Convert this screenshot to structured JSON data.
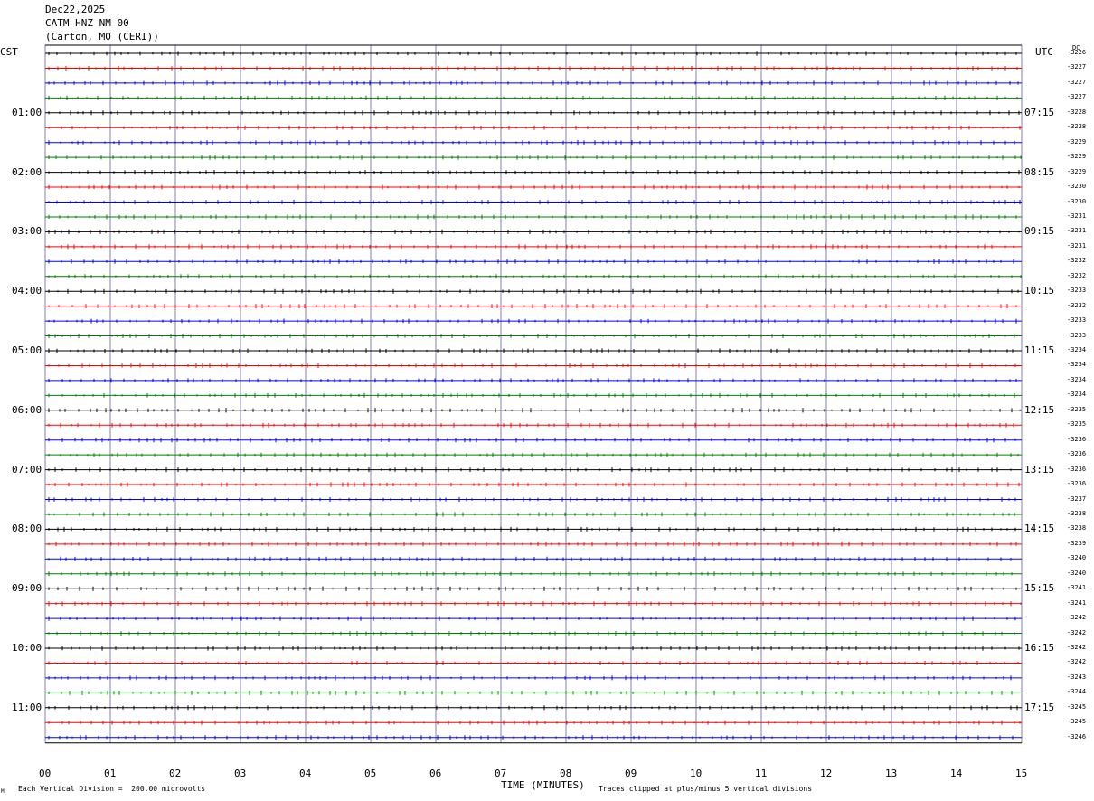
{
  "header": {
    "date": "Dec22,2025",
    "station": "CATM HNZ NM 00",
    "location": "(Carton, MO (CERI))"
  },
  "axes": {
    "left_label": "CST",
    "right_label": "UTC",
    "dc_label": "DC"
  },
  "chart_data": {
    "type": "line",
    "title": "Dec22,2025 CATM HNZ NM 00 (Carton, MO (CERI))",
    "xlabel": "TIME (MINUTES)",
    "x_ticks": [
      "00",
      "01",
      "02",
      "03",
      "04",
      "05",
      "06",
      "07",
      "08",
      "09",
      "10",
      "11",
      "12",
      "13",
      "14",
      "15"
    ],
    "xlim": [
      0,
      15
    ],
    "left_time_labels": [
      "01:00",
      "02:00",
      "03:00",
      "04:00",
      "05:00",
      "06:00",
      "07:00",
      "08:00",
      "09:00",
      "10:00",
      "11:00"
    ],
    "right_time_labels": [
      "07:15",
      "08:15",
      "09:15",
      "10:15",
      "11:15",
      "12:15",
      "13:15",
      "14:15",
      "15:15",
      "16:15",
      "17:15"
    ],
    "trace_colors": [
      "#000000",
      "#ff0000",
      "#0000ff",
      "#008000"
    ],
    "dc_offsets": [
      "-3226",
      "-3227",
      "-3227",
      "-3227",
      "-3228",
      "-3228",
      "-3229",
      "-3229",
      "-3229",
      "-3230",
      "-3230",
      "-3231",
      "-3231",
      "-3231",
      "-3232",
      "-3232",
      "-3233",
      "-3232",
      "-3233",
      "-3233",
      "-3234",
      "-3234",
      "-3234",
      "-3234",
      "-3235",
      "-3235",
      "-3236",
      "-3236",
      "-3236",
      "-3236",
      "-3237",
      "-3238",
      "-3238",
      "-3239",
      "-3240",
      "-3240",
      "-3241",
      "-3241",
      "-3242",
      "-3242",
      "-3242",
      "-3242",
      "-3243",
      "-3244",
      "-3245",
      "-3245",
      "-3246"
    ],
    "grid": true,
    "scale_note": "Each Vertical Division =  200.00 microvolts",
    "clip_note": "Traces clipped at plus/minus 5 vertical divisions",
    "corner_mark": "M"
  }
}
